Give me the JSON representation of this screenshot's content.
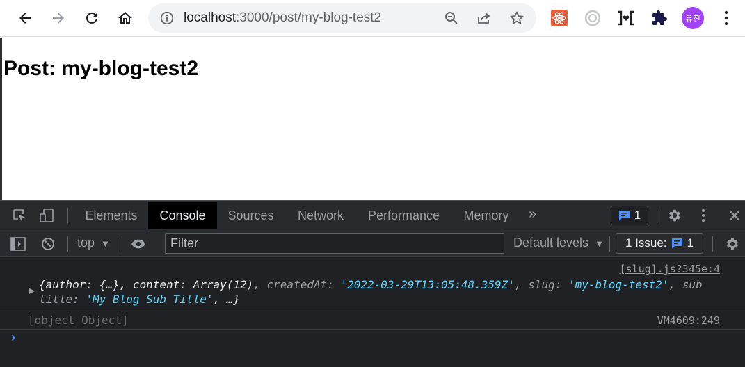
{
  "browser": {
    "url_host": "localhost",
    "url_path": ":3000/post/my-blog-test2",
    "avatar_text": "유진",
    "icons": {
      "back": "back-arrow-icon",
      "forward": "forward-arrow-icon",
      "reload": "reload-icon",
      "home": "home-icon",
      "info": "info-icon",
      "zoom": "zoom-icon",
      "share": "share-icon",
      "bookmark": "star-icon",
      "extensions": "puzzle-icon"
    }
  },
  "page": {
    "heading": "Post: my-blog-test2"
  },
  "devtools": {
    "tabs": [
      "Elements",
      "Console",
      "Sources",
      "Network",
      "Performance",
      "Memory"
    ],
    "active_tab": "Console",
    "messages_badge_count": "1",
    "context": "top",
    "filter_placeholder": "Filter",
    "levels_label": "Default levels",
    "issues_label": "1 Issue:",
    "issues_count": "1",
    "console": {
      "entry1": {
        "source": "[slug].js?345e:4",
        "p1": "{author: {…}, content: ",
        "p1_content_val": "Array(12)",
        "p1_created_key": ", createdAt: ",
        "p1_created_val": "'2022-03-29T13:05:48.359Z'",
        "p1_slug_key": ", slug: ",
        "p1_slug_val": "'my-blog-test2'",
        "p1_tail": ", sub",
        "p2_key": "title: ",
        "p2_val": "'My Blog Sub Title'",
        "p2_tail": ", …}"
      },
      "entry2": {
        "text": "[object Object]",
        "source": "VM4609:249"
      }
    },
    "colors": {
      "string_value": "#5cd5fb",
      "link_blue": "#4c8df6"
    }
  }
}
